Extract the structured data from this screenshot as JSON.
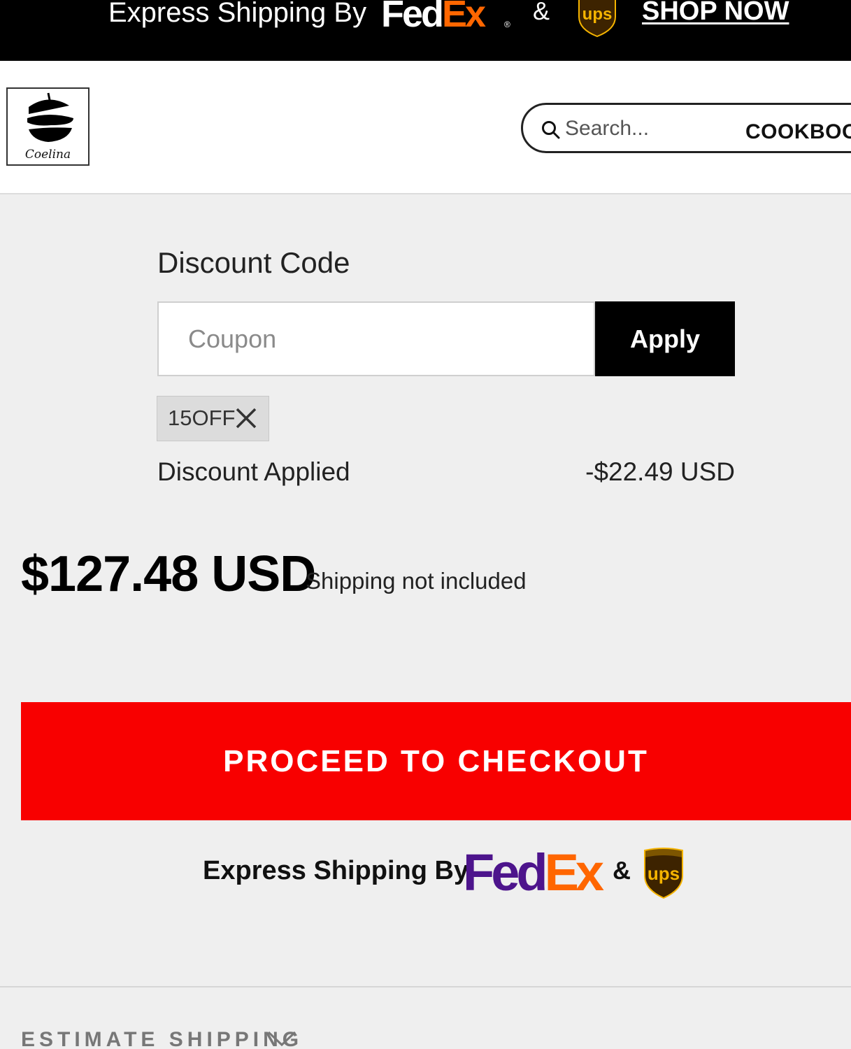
{
  "banner": {
    "text": "Express Shipping By",
    "fedex_fed": "Fed",
    "fedex_ex": "Ex",
    "registered": "®",
    "amp": "&",
    "ups": "ups",
    "shop_now": "SHOP NOW"
  },
  "header": {
    "logo_text": "Coelina",
    "search_placeholder": "Search...",
    "nav_item": "COOKBOOK"
  },
  "discount": {
    "title": "Discount Code",
    "coupon_placeholder": "Coupon",
    "apply_label": "Apply",
    "applied_code": "15OFF",
    "applied_label": "Discount Applied",
    "applied_amount": "-$22.49 USD"
  },
  "total": {
    "amount": "$127.48 USD",
    "note": "Shipping not included"
  },
  "checkout": {
    "label": "PROCEED TO CHECKOUT"
  },
  "express": {
    "text": "Express Shipping By",
    "fedex_fed": "Fed",
    "fedex_ex": "Ex",
    "amp": "&",
    "ups": "ups"
  },
  "estimate": {
    "label": "ESTIMATE SHIPPING"
  },
  "colors": {
    "checkout_red": "#f80000",
    "fedex_purple": "#4d148c",
    "fedex_orange": "#ff6600",
    "ups_brown": "#3d2300",
    "ups_gold": "#f5b400"
  }
}
